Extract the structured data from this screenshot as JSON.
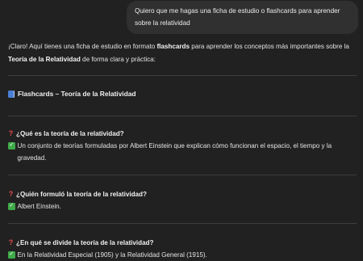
{
  "user_message": {
    "text": "Quiero que me hagas una ficha de estudio o flashcards para aprender sobre la relatividad"
  },
  "response": {
    "intro": {
      "part1": "¡Claro! Aquí tienes una ficha de estudio en formato ",
      "bold1": "flashcards",
      "part2": " para aprender los conceptos más importantes sobre la ",
      "bold2": "Teoría de la Relatividad",
      "part3": " de forma clara y práctica:"
    },
    "heading": {
      "icon": "blue-book-icon",
      "text": "Flashcards – Teoría de la Relatividad"
    },
    "cards": [
      {
        "question": "¿Qué es la teoría de la relatividad?",
        "answer": "Un conjunto de teorías formuladas por Albert Einstein que explican cómo funcionan el espacio, el tiempo y la gravedad."
      },
      {
        "question": "¿Quién formuló la teoría de la relatividad?",
        "answer": "Albert Einstein."
      },
      {
        "question": "¿En qué se divide la teoría de la relatividad?",
        "answer": "En la Relatividad Especial (1905) y la Relatividad General (1915)."
      }
    ],
    "icons": {
      "question": "red-question-mark-icon",
      "answer": "green-checkmark-icon"
    },
    "colors": {
      "background": "#212121",
      "user_bubble": "#303030",
      "text": "#ececec",
      "question_mark": "#e5484d",
      "checkmark": "#3faa48",
      "book": "#4a7fd4"
    }
  }
}
